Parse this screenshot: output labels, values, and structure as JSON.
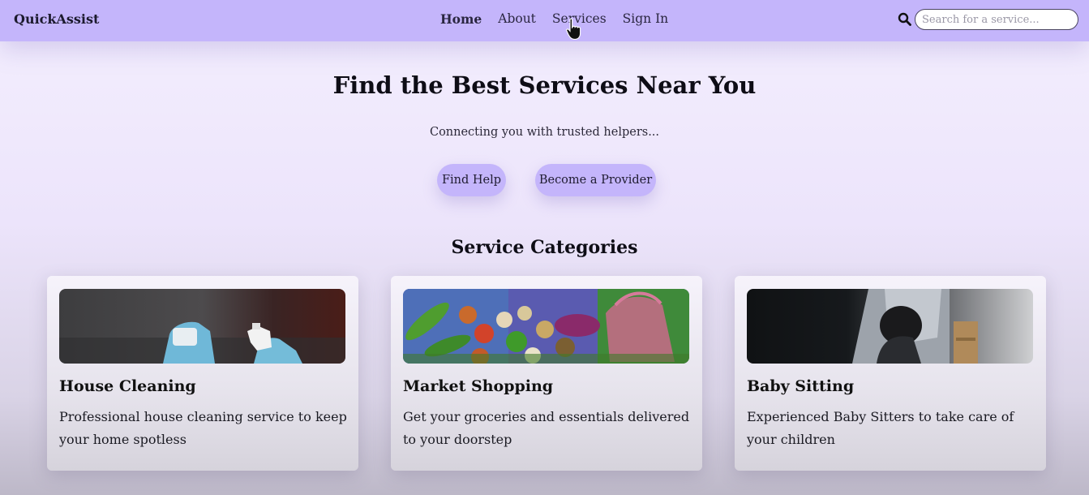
{
  "nav": {
    "brand": "QuickAssist",
    "links": [
      "Home",
      "About",
      "Services",
      "Sign In"
    ],
    "active_link": "Home",
    "search_placeholder": "Search for a service..."
  },
  "hero": {
    "title": "Find the Best Services Near You",
    "subtitle": "Connecting you with trusted helpers...",
    "buttons": [
      "Find Help",
      "Become a Provider"
    ]
  },
  "categories": {
    "title": "Service Categories",
    "cards": [
      {
        "title": "House Cleaning",
        "description": "Professional house cleaning service to keep your home spotless",
        "image": "gloved-hands-cleaning-photo"
      },
      {
        "title": "Market Shopping",
        "description": "Get your groceries and essentials delivered to your doorstep",
        "image": "vegetables-and-shopping-bag-photo"
      },
      {
        "title": "Baby Sitting",
        "description": "Experienced Baby Sitters to take care of your children",
        "image": "caregiver-with-child-photo"
      }
    ]
  },
  "colors": {
    "navbar": "#c4b5fb",
    "button": "#c4b5fb",
    "page_background": "#f4effe"
  },
  "icons": [
    "search-icon",
    "hand-pointer-cursor-icon"
  ]
}
